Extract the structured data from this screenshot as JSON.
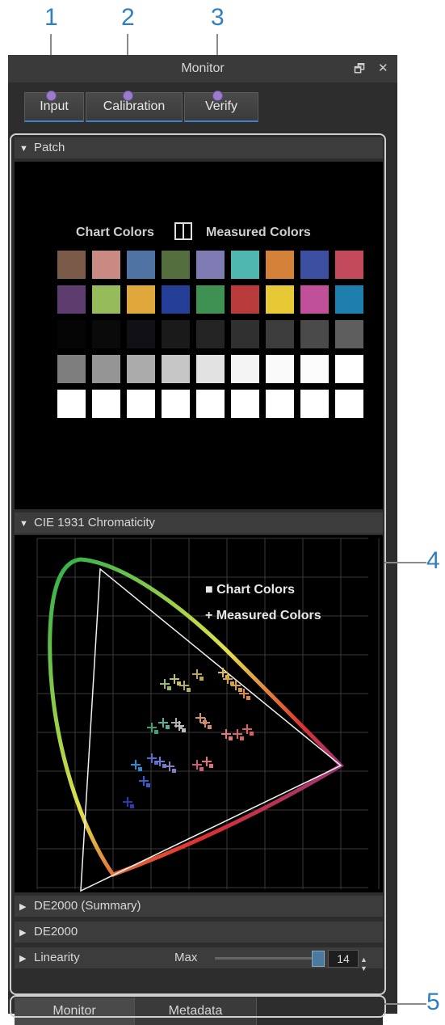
{
  "callouts": {
    "n1": "1",
    "n2": "2",
    "n3": "3",
    "n4": "4",
    "n5": "5"
  },
  "window": {
    "title": "Monitor",
    "restore_icon": "restore-icon",
    "close_icon": "close-icon",
    "restore_glyph": "🗗",
    "close_glyph": "✕"
  },
  "top_tabs": [
    {
      "label": "Input"
    },
    {
      "label": "Calibration"
    },
    {
      "label": "Verify"
    }
  ],
  "patch": {
    "header": "Patch",
    "chart_colors_label": "Chart Colors",
    "measured_colors_label": "Measured Colors",
    "split_icon": "split-view-icon",
    "rows": [
      [
        "#7a5a48",
        "#c98a84",
        "#4f74a3",
        "#556e3e",
        "#7f7cb3",
        "#4fb7b0",
        "#d4823a",
        "#3d4fa0",
        "#c24a5a"
      ],
      [
        "#5c3d6e",
        "#96bb5a",
        "#e0a83a",
        "#253f98",
        "#3f9152",
        "#b83a3a",
        "#e7c835",
        "#c0509a",
        "#1e7fae"
      ],
      [
        "#050505",
        "#0a0a0a",
        "#111014",
        "#1a1a1a",
        "#242424",
        "#303030",
        "#3c3c3c",
        "#4a4a4a",
        "#5e5e5e"
      ],
      [
        "#7e7e7e",
        "#959595",
        "#ababab",
        "#c6c6c6",
        "#e2e2e2",
        "#f4f4f4",
        "#fafafa",
        "#fcfcfc",
        "#ffffff"
      ],
      [
        "#ffffff",
        "#ffffff",
        "#ffffff",
        "#ffffff",
        "#ffffff",
        "#ffffff",
        "#ffffff",
        "#ffffff",
        "#ffffff"
      ]
    ]
  },
  "cie": {
    "header": "CIE 1931 Chromaticity",
    "legend_chart": "■ Chart Colors",
    "legend_measured": "+ Measured Colors"
  },
  "collapsed_sections": [
    {
      "label": "DE2000 (Summary)"
    },
    {
      "label": "DE2000"
    },
    {
      "label": "Linearity"
    }
  ],
  "linearity": {
    "max_label": "Max",
    "value": "14"
  },
  "bottom_tabs": [
    {
      "label": "Monitor"
    },
    {
      "label": "Metadata"
    }
  ],
  "colors": {
    "accent": "#3a7fd0",
    "callout_text": "#2f7fc1"
  }
}
